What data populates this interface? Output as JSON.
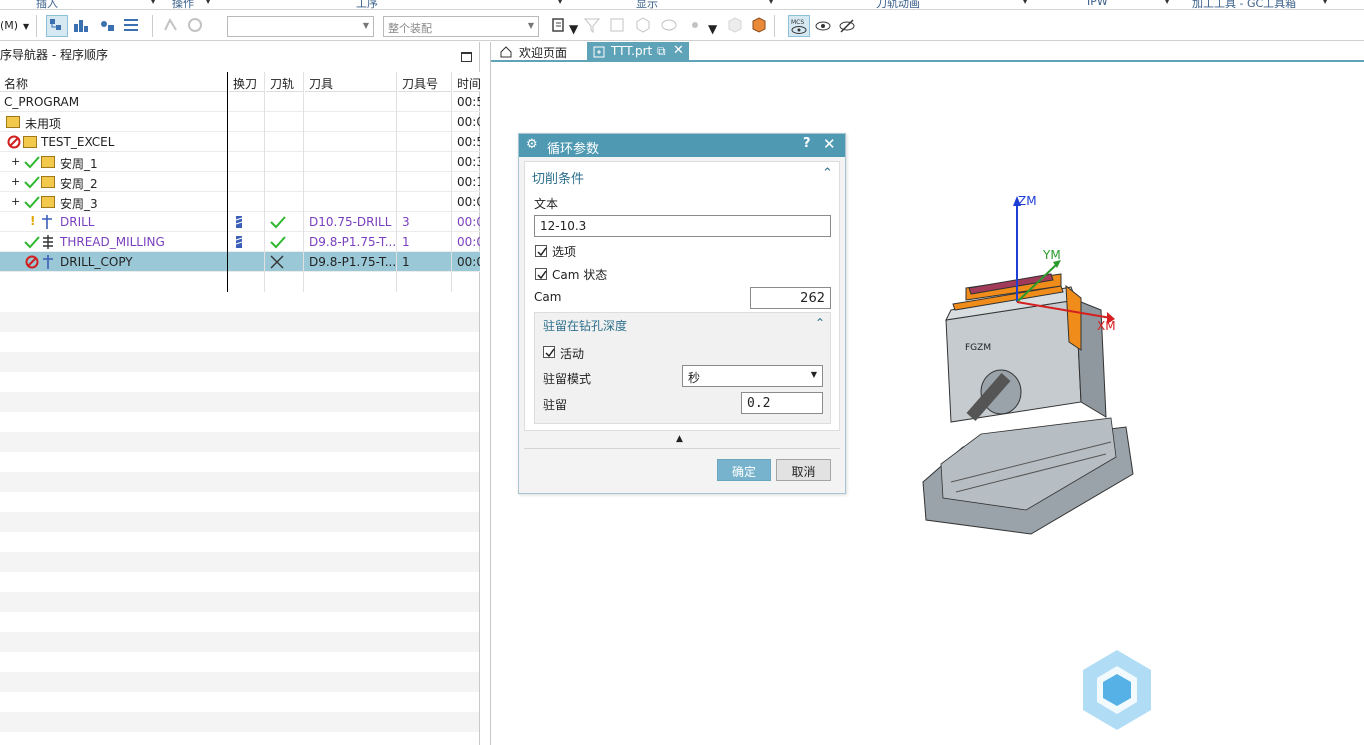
{
  "ribbon": {
    "groups": [
      "插入",
      "操作",
      "工序",
      "显示",
      "刀轨动画",
      "IPW",
      "加工工具 - GC工具箱"
    ]
  },
  "toolbar": {
    "mode_label": "(M)",
    "combo1_value": "",
    "combo2_placeholder": "整个装配"
  },
  "navigator": {
    "title": "序导航器 - 程序顺序",
    "columns": [
      "名称",
      "换刀",
      "刀轨",
      "刀具",
      "刀具号",
      "时间"
    ],
    "rows": [
      {
        "name": "C_PROGRAM",
        "toolchange": "",
        "path": "",
        "tool": "",
        "tool_no": "",
        "time": "00:5"
      },
      {
        "name": "未用项",
        "toolchange": "",
        "path": "",
        "tool": "",
        "tool_no": "",
        "time": "00:0"
      },
      {
        "name": "TEST_EXCEL",
        "toolchange": "",
        "path": "",
        "tool": "",
        "tool_no": "",
        "time": "00:5"
      },
      {
        "name": "安周_1",
        "toolchange": "",
        "path": "",
        "tool": "",
        "tool_no": "",
        "time": "00:3"
      },
      {
        "name": "安周_2",
        "toolchange": "",
        "path": "",
        "tool": "",
        "tool_no": "",
        "time": "00:1"
      },
      {
        "name": "安周_3",
        "toolchange": "",
        "path": "",
        "tool": "",
        "tool_no": "",
        "time": "00:0"
      },
      {
        "name": "DRILL",
        "toolchange": "",
        "path": "",
        "tool": "D10.75-DRILL",
        "tool_no": "3",
        "time": "00:0"
      },
      {
        "name": "THREAD_MILLING",
        "toolchange": "",
        "path": "",
        "tool": "D9.8-P1.75-T...",
        "tool_no": "1",
        "time": "00:0"
      },
      {
        "name": "DRILL_COPY",
        "toolchange": "",
        "path": "",
        "tool": "D9.8-P1.75-T...",
        "tool_no": "1",
        "time": "00:0"
      }
    ]
  },
  "graphics": {
    "tabs": [
      "欢迎页面",
      "TTT.prt"
    ],
    "axes": {
      "zm": "ZM",
      "ym": "YM",
      "xm": "XM"
    },
    "part_marking": "FGZM"
  },
  "dialog": {
    "title": "循环参数",
    "section1": "切削条件",
    "text_label": "文本",
    "text_value": "12-10.3",
    "option_label": "选项",
    "cam_state_label": "Cam 状态",
    "cam_label": "Cam",
    "cam_value": "262",
    "section2": "驻留在钻孔深度",
    "active_label": "活动",
    "dwell_mode_label": "驻留模式",
    "dwell_mode_value": "秒",
    "dwell_label": "驻留",
    "dwell_value": "0.2",
    "ok": "确定",
    "cancel": "取消"
  },
  "colors": {
    "accent": "#4f9ab2",
    "selection": "#9ac8d6",
    "check_green": "#2fb82f",
    "error_red": "#d21f1f",
    "purple_text": "#7a3fbf"
  }
}
